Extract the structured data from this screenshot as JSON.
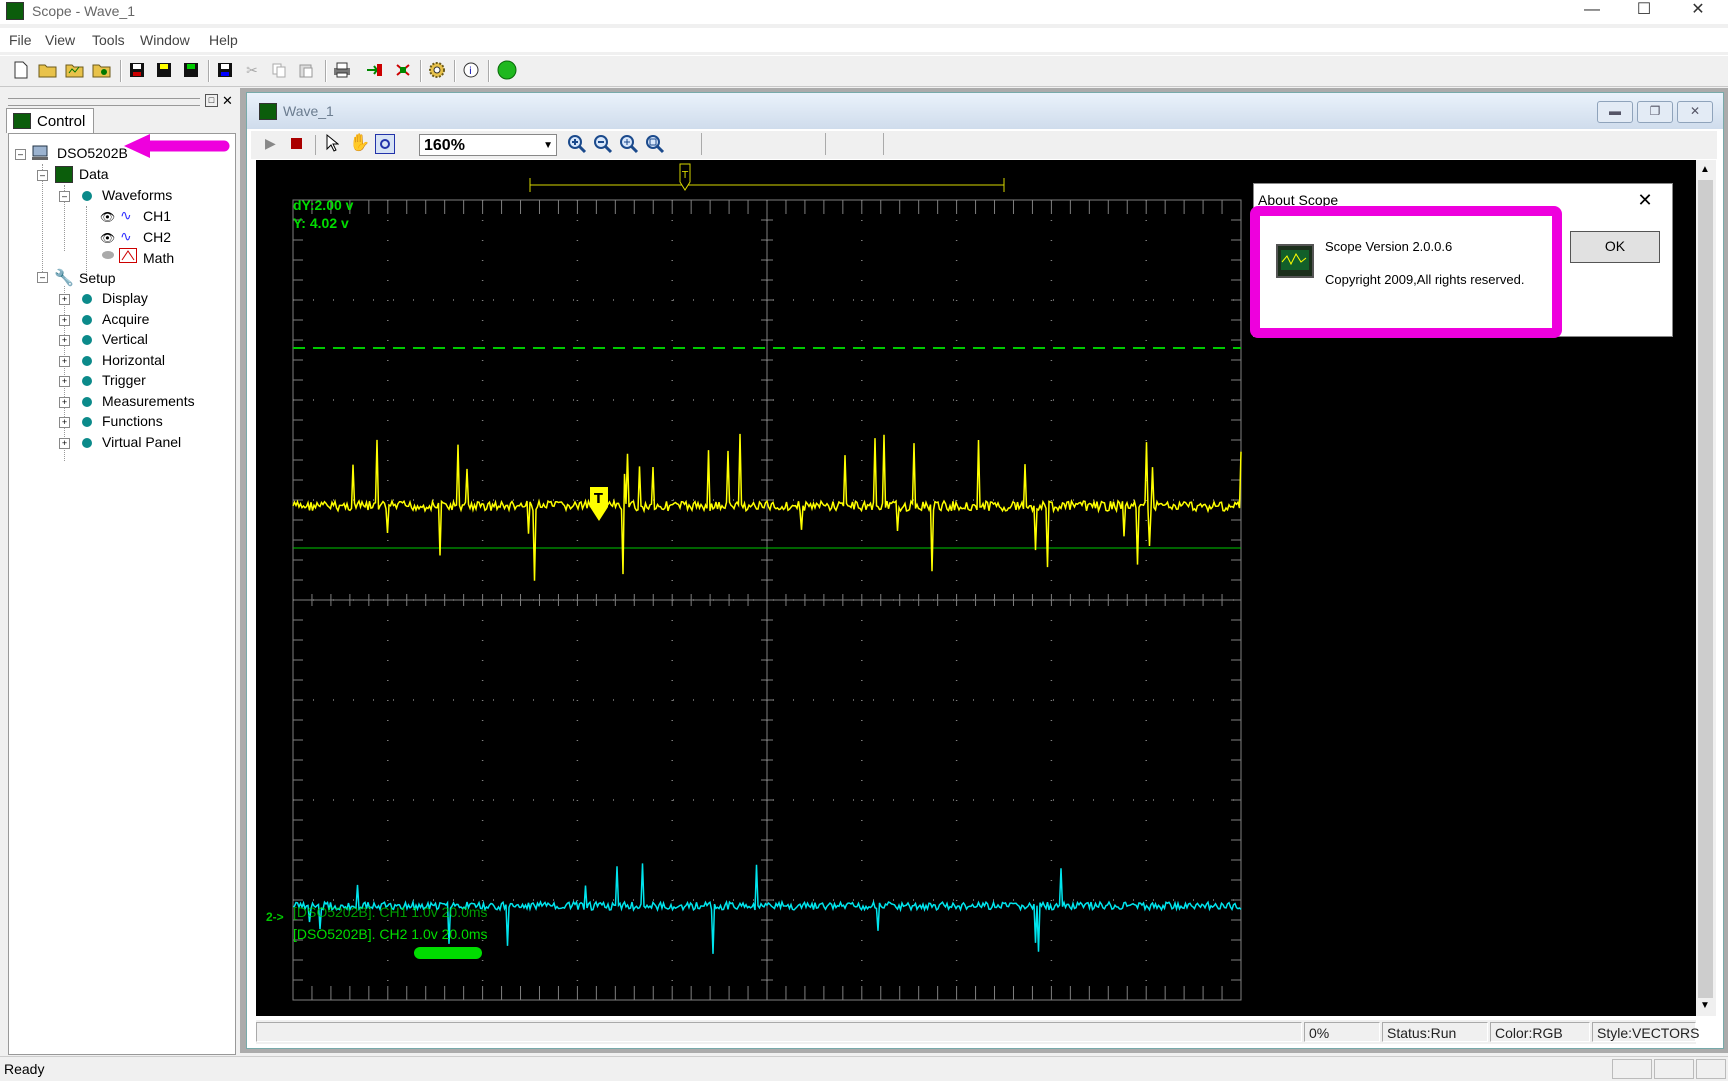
{
  "window": {
    "title": "Scope - Wave_1"
  },
  "menu": [
    "File",
    "View",
    "Tools",
    "Window",
    "Help"
  ],
  "control_panel": {
    "tab_label": "Control",
    "tree": {
      "root": "DSO5202B",
      "data": "Data",
      "waveforms": "Waveforms",
      "ch1": "CH1",
      "ch2": "CH2",
      "math": "Math",
      "setup": "Setup",
      "setup_items": [
        "Display",
        "Acquire",
        "Vertical",
        "Horizontal",
        "Trigger",
        "Measurements",
        "Functions",
        "Virtual Panel"
      ]
    }
  },
  "wave_window": {
    "title": "Wave_1",
    "zoom": "160%",
    "readout": {
      "dy": "dY:2.00 v",
      "y": "Y:  4.02 v"
    },
    "ch2_marker": "2->",
    "ch2_label_line1": "[DSO5202B]. CH1 1.0v 20.0ms",
    "ch2_label_line2": "[DSO5202B]. CH2 1.0v 20.0ms",
    "trigger_marker": "T",
    "colors": {
      "ch1": "#ffff00",
      "ch2": "#00e5ee",
      "cursor": "#00c800",
      "grid": "#7f7f7f"
    }
  },
  "status_cells": {
    "progress": "0%",
    "status": "Status:Run",
    "color": "Color:RGB",
    "style": "Style:VECTORS"
  },
  "about_dialog": {
    "title": "About Scope",
    "version": "Scope Version 2.0.0.6",
    "copyright": "Copyright 2009,All rights reserved.",
    "ok_label": "OK"
  },
  "statusbar": {
    "text": "Ready"
  }
}
